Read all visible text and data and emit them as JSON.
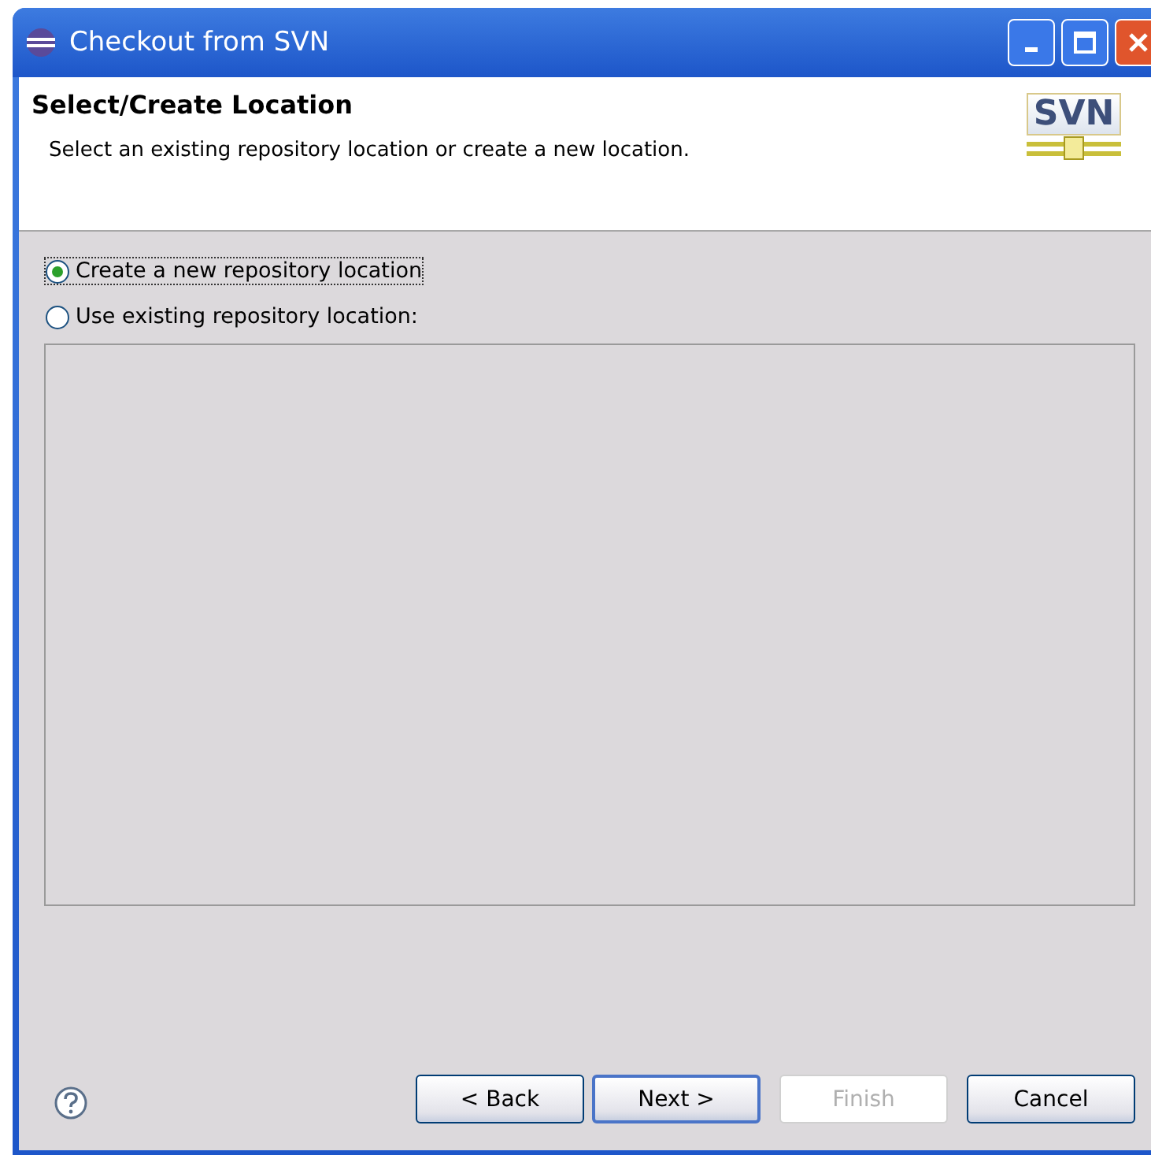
{
  "window": {
    "title": "Checkout from SVN"
  },
  "header": {
    "title": "Select/Create Location",
    "description": "Select an existing repository location or create a new location.",
    "logo": "SVN"
  },
  "options": [
    {
      "label": "Create a new repository location",
      "selected": true
    },
    {
      "label": "Use existing repository location:",
      "selected": false
    }
  ],
  "buttons": [
    {
      "label": "< Back",
      "disabled": false,
      "default": false
    },
    {
      "label": "Next >",
      "disabled": false,
      "default": true
    },
    {
      "label": "Finish",
      "disabled": true,
      "default": false
    },
    {
      "label": "Cancel",
      "disabled": false,
      "default": false
    }
  ]
}
